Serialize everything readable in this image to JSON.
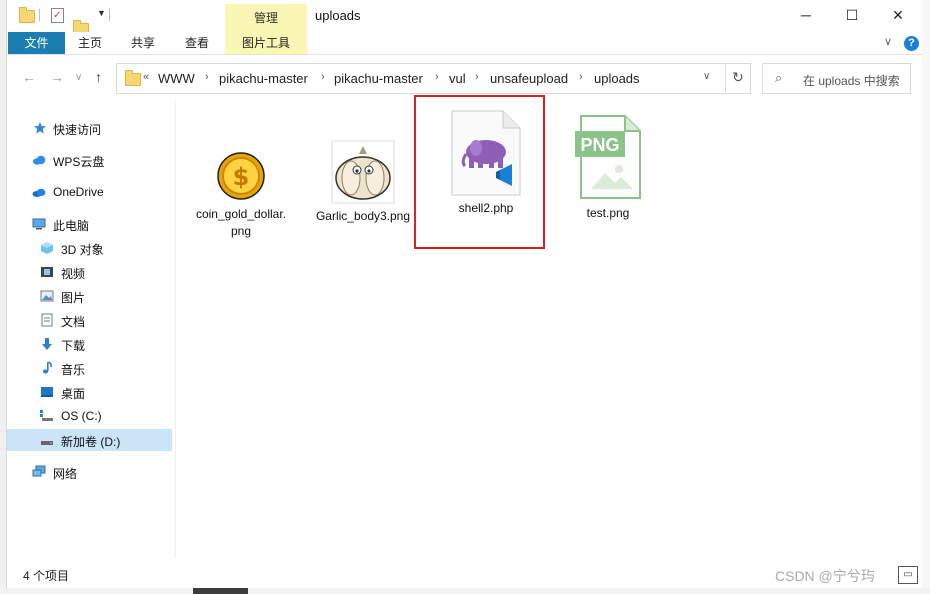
{
  "window": {
    "title": "uploads",
    "contextual_tab_group": "管理",
    "controls": {
      "minimize": "─",
      "maximize": "☐",
      "close": "✕"
    }
  },
  "ribbon": {
    "tabs": [
      {
        "label": "文件",
        "kind": "file"
      },
      {
        "label": "主页",
        "kind": "normal"
      },
      {
        "label": "共享",
        "kind": "normal"
      },
      {
        "label": "查看",
        "kind": "normal"
      },
      {
        "label": "图片工具",
        "kind": "contextual"
      }
    ],
    "expand_icon": "chevron-down-icon",
    "help_label": "?"
  },
  "navigation": {
    "back_icon": "←",
    "forward_icon": "→",
    "history_icon": "∨",
    "up_icon": "↑"
  },
  "address_bar": {
    "overflow": "«",
    "crumbs": [
      "WWW",
      "pikachu-master",
      "pikachu-master",
      "vul",
      "unsafeupload",
      "uploads"
    ],
    "separator": "›",
    "dropdown_icon": "∨",
    "refresh_icon": "↻"
  },
  "search": {
    "placeholder": "在 uploads 中搜索",
    "icon": "⌕"
  },
  "sidebar": {
    "items": [
      {
        "label": "快速访问",
        "icon": "star-icon",
        "indent": 0,
        "selected": false
      },
      {
        "label": "WPS云盘",
        "icon": "cloud-icon",
        "indent": 0,
        "selected": false
      },
      {
        "label": "OneDrive",
        "icon": "onedrive-icon",
        "indent": 0,
        "selected": false
      },
      {
        "label": "此电脑",
        "icon": "computer-icon",
        "indent": 0,
        "selected": false
      },
      {
        "label": "3D 对象",
        "icon": "cube-icon",
        "indent": 1,
        "selected": false
      },
      {
        "label": "视频",
        "icon": "video-icon",
        "indent": 1,
        "selected": false
      },
      {
        "label": "图片",
        "icon": "picture-icon",
        "indent": 1,
        "selected": false
      },
      {
        "label": "文档",
        "icon": "document-icon",
        "indent": 1,
        "selected": false
      },
      {
        "label": "下载",
        "icon": "download-icon",
        "indent": 1,
        "selected": false
      },
      {
        "label": "音乐",
        "icon": "music-icon",
        "indent": 1,
        "selected": false
      },
      {
        "label": "桌面",
        "icon": "desktop-icon",
        "indent": 1,
        "selected": false
      },
      {
        "label": "OS (C:)",
        "icon": "drive-os-icon",
        "indent": 1,
        "selected": false
      },
      {
        "label": "新加卷 (D:)",
        "icon": "drive-icon",
        "indent": 1,
        "selected": true
      },
      {
        "label": "网络",
        "icon": "network-icon",
        "indent": 0,
        "selected": false
      }
    ]
  },
  "files": [
    {
      "name": "coin_gold_dollar.png",
      "icon": "gold-coin-icon",
      "highlighted": false
    },
    {
      "name": "Garlic_body3.png",
      "icon": "garlic-icon",
      "highlighted": false
    },
    {
      "name": "shell2.php",
      "icon": "php-file-icon",
      "highlighted": true
    },
    {
      "name": "test.png",
      "icon": "png-file-icon",
      "badge": "PNG",
      "highlighted": false
    }
  ],
  "status": {
    "item_count": "4 个项目"
  },
  "watermark": "CSDN @宁兮玙",
  "colors": {
    "file_tab": "#1a7fb0",
    "contextual_tab": "#faf6b4",
    "selection": "#cce4f7",
    "highlight_border": "#e02020",
    "php_elephant": "#8f5fb8",
    "vscode_blue": "#1a7fd6",
    "png_green": "#8bc48a"
  }
}
